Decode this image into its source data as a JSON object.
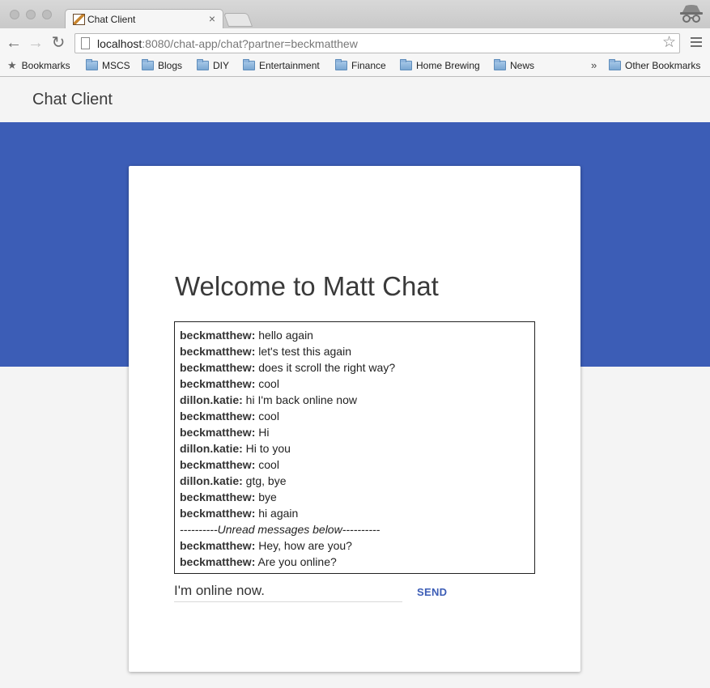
{
  "browser": {
    "tab_title": "Chat Client",
    "tab_close": "×",
    "url_host": "localhost",
    "url_rest": ":8080/chat-app/chat?partner=beckmatthew",
    "overflow_chevron": "»",
    "bookmarks_label": "Bookmarks",
    "bookmark_folders": [
      "MSCS",
      "Blogs",
      "DIY",
      "Entertainment",
      "Finance",
      "Home Brewing",
      "News"
    ],
    "other_bookmarks": "Other Bookmarks"
  },
  "app": {
    "header_title": "Chat Client",
    "welcome": "Welcome to Matt Chat",
    "input_value": "I'm online now.",
    "send_label": "SEND",
    "brand_color": "#3c5db6"
  },
  "messages": [
    {
      "user": "beckmatthew:",
      "text": " hello again"
    },
    {
      "user": "beckmatthew:",
      "text": " let's test this again"
    },
    {
      "user": "beckmatthew:",
      "text": " does it scroll the right way?"
    },
    {
      "user": "beckmatthew:",
      "text": " cool"
    },
    {
      "user": "dillon.katie:",
      "text": " hi I'm back online now"
    },
    {
      "user": "beckmatthew:",
      "text": " cool"
    },
    {
      "user": "beckmatthew:",
      "text": " Hi"
    },
    {
      "user": "dillon.katie:",
      "text": " Hi to you"
    },
    {
      "user": "beckmatthew:",
      "text": " cool"
    },
    {
      "user": "dillon.katie:",
      "text": " gtg, bye"
    },
    {
      "user": "beckmatthew:",
      "text": " bye"
    },
    {
      "user": "beckmatthew:",
      "text": " hi again"
    },
    {
      "divider": "----------Unread messages below----------"
    },
    {
      "user": "beckmatthew:",
      "text": " Hey, how are you?"
    },
    {
      "user": "beckmatthew:",
      "text": " Are you online?"
    }
  ]
}
